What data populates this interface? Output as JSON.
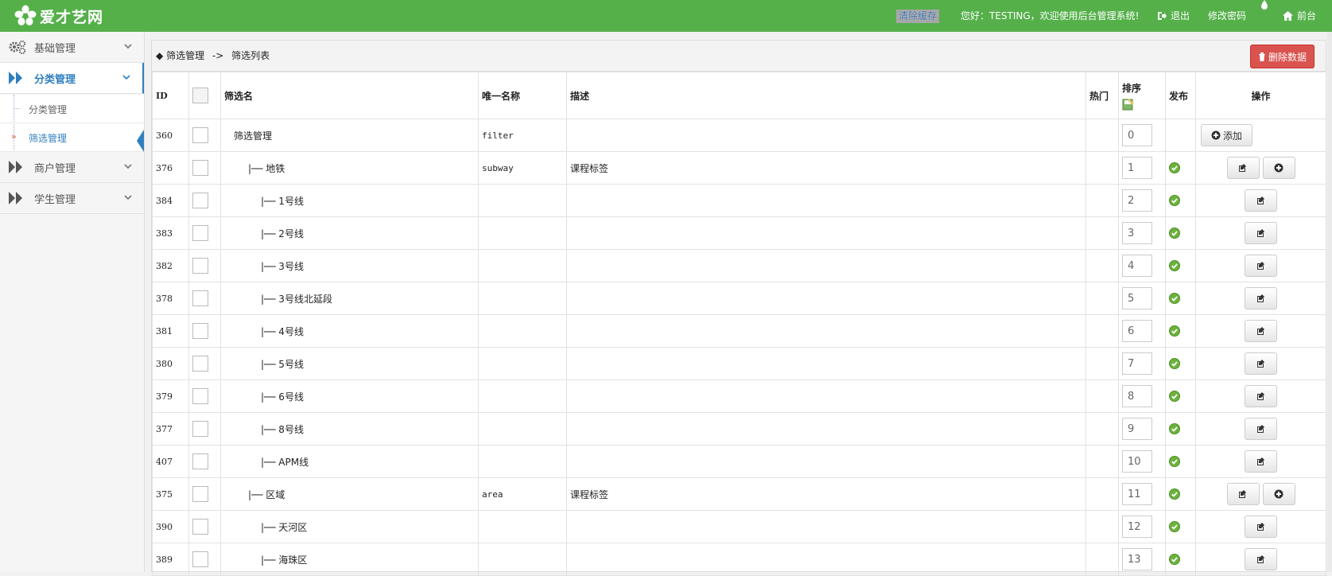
{
  "header": {
    "logo_text": "爱才艺网",
    "clear_cache": "清除缓存",
    "greeting": "您好：TESTING，欢迎使用后台管理系统!",
    "logout": "退出",
    "change_password": "修改密码",
    "frontend": "前台",
    "bg_color": "#55b04a"
  },
  "sidebar": {
    "items": [
      {
        "label": "基础管理",
        "icon": "gears-icon"
      },
      {
        "label": "分类管理",
        "icon": "double-arrow-icon"
      },
      {
        "label": "商户管理",
        "icon": "double-arrow-icon"
      },
      {
        "label": "学生管理",
        "icon": "double-arrow-icon"
      }
    ],
    "sub_items": [
      {
        "label": "分类管理"
      },
      {
        "label": "筛选管理"
      }
    ]
  },
  "breadcrumb": {
    "part1": "筛选管理",
    "sep": "->",
    "part2": "筛选列表"
  },
  "delete_button": "删除数据",
  "table": {
    "headers": {
      "id": "ID",
      "name": "筛选名",
      "unique": "唯一名称",
      "desc": "描述",
      "hot": "热门",
      "sort": "排序",
      "publish": "发布",
      "ops": "操作"
    },
    "add_label": "添加",
    "rows": [
      {
        "id": "360",
        "name": "筛选管理",
        "unique": "filter",
        "desc": "",
        "sort": "0",
        "published": false,
        "ops": "add-text"
      },
      {
        "id": "376",
        "name": "|── 地铁",
        "unique": "subway",
        "desc": "课程标签",
        "sort": "1",
        "published": true,
        "ops": "edit-add"
      },
      {
        "id": "384",
        "name": "|── 1号线",
        "unique": "",
        "desc": "",
        "sort": "2",
        "published": true,
        "ops": "edit"
      },
      {
        "id": "383",
        "name": "|── 2号线",
        "unique": "",
        "desc": "",
        "sort": "3",
        "published": true,
        "ops": "edit"
      },
      {
        "id": "382",
        "name": "|── 3号线",
        "unique": "",
        "desc": "",
        "sort": "4",
        "published": true,
        "ops": "edit"
      },
      {
        "id": "378",
        "name": "|── 3号线北延段",
        "unique": "",
        "desc": "",
        "sort": "5",
        "published": true,
        "ops": "edit"
      },
      {
        "id": "381",
        "name": "|── 4号线",
        "unique": "",
        "desc": "",
        "sort": "6",
        "published": true,
        "ops": "edit"
      },
      {
        "id": "380",
        "name": "|── 5号线",
        "unique": "",
        "desc": "",
        "sort": "7",
        "published": true,
        "ops": "edit"
      },
      {
        "id": "379",
        "name": "|── 6号线",
        "unique": "",
        "desc": "",
        "sort": "8",
        "published": true,
        "ops": "edit"
      },
      {
        "id": "377",
        "name": "|── 8号线",
        "unique": "",
        "desc": "",
        "sort": "9",
        "published": true,
        "ops": "edit"
      },
      {
        "id": "407",
        "name": "|── APM线",
        "unique": "",
        "desc": "",
        "sort": "10",
        "published": true,
        "ops": "edit"
      },
      {
        "id": "375",
        "name": "|── 区域",
        "unique": "area",
        "desc": "课程标签",
        "sort": "11",
        "published": true,
        "ops": "edit-add"
      },
      {
        "id": "390",
        "name": "|── 天河区",
        "unique": "",
        "desc": "",
        "sort": "12",
        "published": true,
        "ops": "edit"
      },
      {
        "id": "389",
        "name": "|── 海珠区",
        "unique": "",
        "desc": "",
        "sort": "13",
        "published": true,
        "ops": "edit"
      }
    ]
  }
}
